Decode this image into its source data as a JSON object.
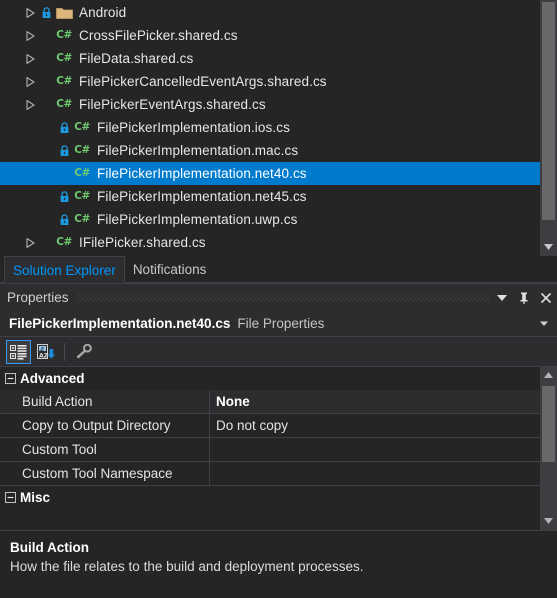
{
  "solution_explorer": {
    "tree_items": [
      {
        "label": "Android",
        "indent": 1,
        "expander": true,
        "lock": true,
        "icon": "folder-icon",
        "selected": false
      },
      {
        "label": "CrossFilePicker.shared.cs",
        "indent": 1,
        "expander": true,
        "lock": false,
        "icon": "csharp-file-icon",
        "selected": false
      },
      {
        "label": "FileData.shared.cs",
        "indent": 1,
        "expander": true,
        "lock": false,
        "icon": "csharp-file-icon",
        "selected": false
      },
      {
        "label": "FilePickerCancelledEventArgs.shared.cs",
        "indent": 1,
        "expander": true,
        "lock": false,
        "icon": "csharp-file-icon",
        "selected": false
      },
      {
        "label": "FilePickerEventArgs.shared.cs",
        "indent": 1,
        "expander": true,
        "lock": false,
        "icon": "csharp-file-icon",
        "selected": false
      },
      {
        "label": "FilePickerImplementation.ios.cs",
        "indent": 2,
        "expander": false,
        "lock": true,
        "icon": "csharp-file-icon",
        "selected": false
      },
      {
        "label": "FilePickerImplementation.mac.cs",
        "indent": 2,
        "expander": false,
        "lock": true,
        "icon": "csharp-file-icon",
        "selected": false
      },
      {
        "label": "FilePickerImplementation.net40.cs",
        "indent": 2,
        "expander": false,
        "lock": false,
        "icon": "csharp-file-icon",
        "selected": true
      },
      {
        "label": "FilePickerImplementation.net45.cs",
        "indent": 2,
        "expander": false,
        "lock": true,
        "icon": "csharp-file-icon",
        "selected": false
      },
      {
        "label": "FilePickerImplementation.uwp.cs",
        "indent": 2,
        "expander": false,
        "lock": true,
        "icon": "csharp-file-icon",
        "selected": false
      },
      {
        "label": "IFilePicker.shared.cs",
        "indent": 1,
        "expander": true,
        "lock": false,
        "icon": "csharp-file-icon",
        "selected": false
      }
    ],
    "selection_color": "#007ACC"
  },
  "tabs": [
    {
      "label": "Solution Explorer",
      "active": true
    },
    {
      "label": "Notifications",
      "active": false
    }
  ],
  "properties_window": {
    "title": "Properties",
    "titlebar_buttons": [
      {
        "name": "window-menu-dropdown",
        "glyph": "▼"
      },
      {
        "name": "auto-hide-pin",
        "glyph": "pin"
      },
      {
        "name": "close",
        "glyph": "✕"
      }
    ],
    "object_row": {
      "object_name": "FilePickerImplementation.net40.cs",
      "object_type": "File Properties",
      "dropdown_glyph": "▾"
    },
    "toolbar": [
      {
        "name": "categorized-view-button",
        "checked": true
      },
      {
        "name": "alphabetical-sort-button",
        "checked": false
      },
      {
        "name": "property-pages-button",
        "checked": false
      }
    ],
    "grid": {
      "categories": [
        {
          "name": "Advanced",
          "expanded": true,
          "rows": [
            {
              "name": "Build Action",
              "value": "None",
              "selected": true
            },
            {
              "name": "Copy to Output Directory",
              "value": "Do not copy",
              "selected": false
            },
            {
              "name": "Custom Tool",
              "value": "",
              "selected": false
            },
            {
              "name": "Custom Tool Namespace",
              "value": "",
              "selected": false
            }
          ]
        },
        {
          "name": "Misc",
          "expanded": true,
          "rows": []
        }
      ]
    },
    "description": {
      "title": "Build Action",
      "text": "How the file relates to the build and deployment processes."
    }
  }
}
